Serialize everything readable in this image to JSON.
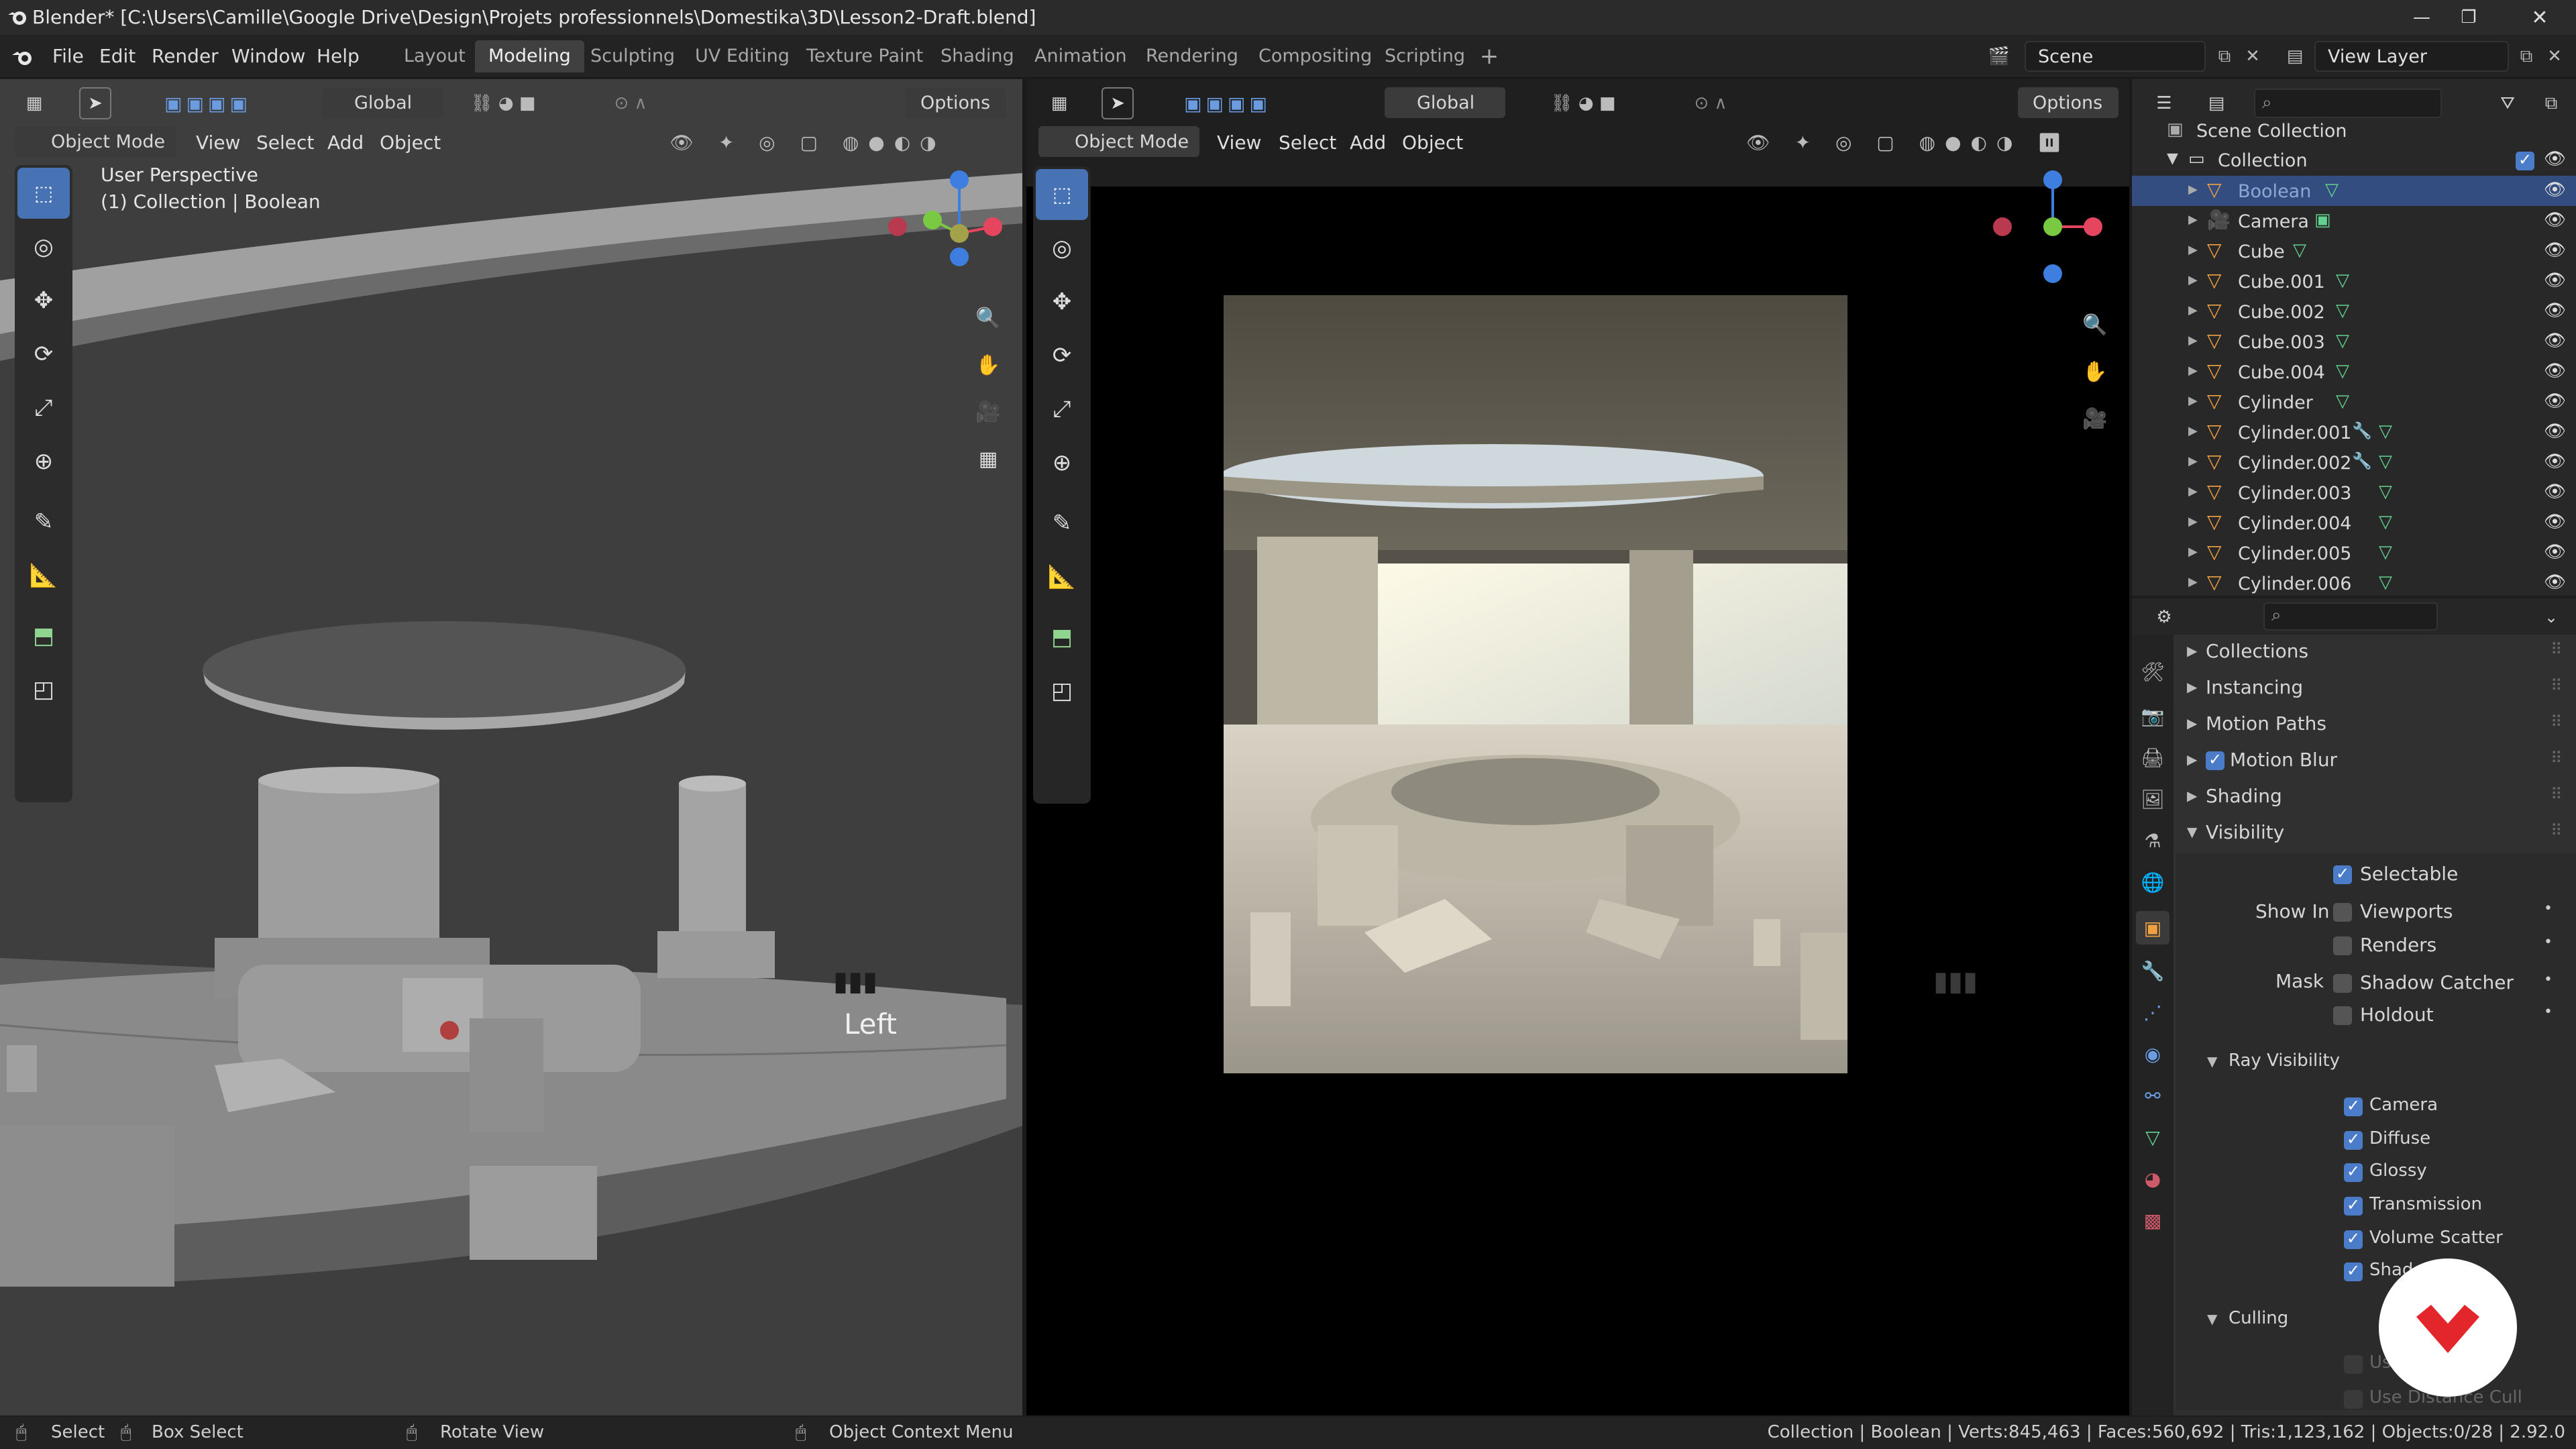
{
  "window": {
    "title": "Blender* [C:\\Users\\Camille\\Google Drive\\Design\\Projets professionnels\\Domestika\\3D\\Lesson2-Draft.blend]"
  },
  "menu": [
    "File",
    "Edit",
    "Render",
    "Window",
    "Help"
  ],
  "workspaces": [
    "Layout",
    "Modeling",
    "Sculpting",
    "UV Editing",
    "Texture Paint",
    "Shading",
    "Animation",
    "Rendering",
    "Compositing",
    "Scripting"
  ],
  "active_workspace": "Modeling",
  "scene": {
    "scene_name": "Scene",
    "view_layer": "View Layer"
  },
  "left_viewport": {
    "transform": "Global",
    "options": "Options",
    "mode": "Object Mode",
    "menus": [
      "View",
      "Select",
      "Add",
      "Object"
    ],
    "overlay_line1": "User Perspective",
    "overlay_line2": "(1) Collection | Boolean",
    "view_label": "Left"
  },
  "right_viewport": {
    "transform": "Global",
    "options": "Options",
    "mode": "Object Mode",
    "menus": [
      "View",
      "Select",
      "Add",
      "Object"
    ]
  },
  "outliner": {
    "root": "Scene Collection",
    "collection": "Collection",
    "items": [
      "Boolean",
      "Camera",
      "Cube",
      "Cube.001",
      "Cube.002",
      "Cube.003",
      "Cube.004",
      "Cylinder",
      "Cylinder.001",
      "Cylinder.002",
      "Cylinder.003",
      "Cylinder.004",
      "Cylinder.005",
      "Cylinder.006"
    ],
    "selected": "Boolean"
  },
  "properties": {
    "panels": [
      "Collections",
      "Instancing",
      "Motion Paths",
      "Motion Blur",
      "Shading",
      "Visibility"
    ],
    "selectable": "Selectable",
    "show_in_label": "Show In",
    "viewports": "Viewports",
    "renders": "Renders",
    "mask_label": "Mask",
    "shadow_catcher": "Shadow Catcher",
    "holdout": "Holdout",
    "ray_visibility": "Ray Visibility",
    "ray_items": [
      "Camera",
      "Diffuse",
      "Glossy",
      "Transmission",
      "Volume Scatter",
      "Shad"
    ],
    "culling": "Culling",
    "culling_items": [
      "Us",
      "Use Distance Cull"
    ]
  },
  "statusbar": {
    "select": "Select",
    "box_select": "Box Select",
    "rotate_view": "Rotate View",
    "context_menu": "Object Context Menu",
    "stats": "Collection | Boolean | Verts:845,463 | Faces:560,692 | Tris:1,123,162 | Objects:0/28 | 2.92.0"
  },
  "colors": {
    "accent": "#4772b3",
    "checkbox": "#4a7cc9",
    "brand": "#e3262b"
  }
}
